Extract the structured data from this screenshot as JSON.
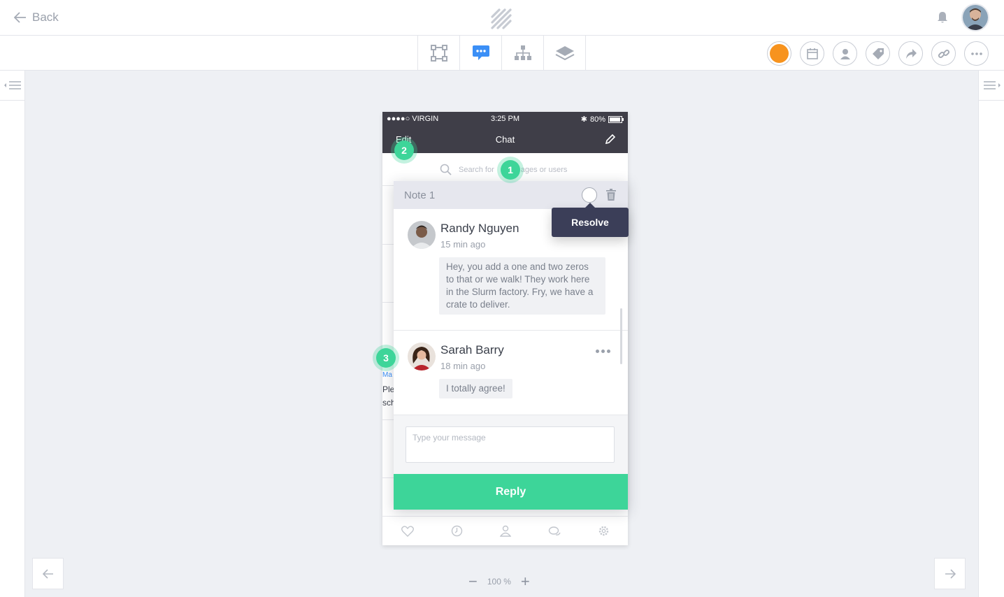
{
  "topbar": {
    "back_label": "Back"
  },
  "toolbar": {
    "modes": [
      "layout-icon",
      "comment-icon",
      "sitemap-icon",
      "layers-icon"
    ],
    "active_mode": "comment-icon",
    "color_swatch": "#f7931e",
    "accent": "#3b8ff6"
  },
  "phone": {
    "carrier": "●●●●○ VIRGIN",
    "time": "3:25 PM",
    "battery": "80%",
    "nav_edit": "Edit",
    "nav_title": "Chat",
    "search_placeholder": "Search for messages or users",
    "search_visible_1": "Search for",
    "search_visible_2": "ages or users",
    "peek_1": "Ma",
    "peek_2": "Ple",
    "peek_3": "sch"
  },
  "note": {
    "title": "Note 1",
    "tooltip": "Resolve",
    "messages": [
      {
        "author": "Randy Nguyen",
        "time": "15 min ago",
        "text": "Hey, you add a one and two zeros to that or we walk! They work here in the Slurm factory. Fry, we have a crate to deliver."
      },
      {
        "author": "Sarah Barry",
        "time": "18 min ago",
        "text": "I totally agree!"
      }
    ],
    "input_placeholder": "Type your message",
    "reply_label": "Reply"
  },
  "markers": [
    "1",
    "2",
    "3"
  ],
  "zoom": {
    "level": "100 %"
  }
}
